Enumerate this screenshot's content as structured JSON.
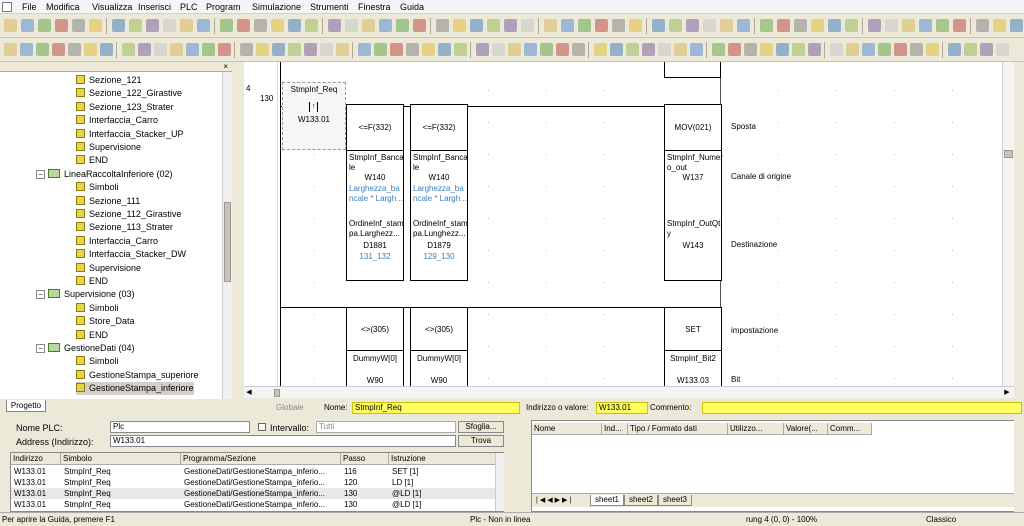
{
  "menu": [
    "File",
    "Modifica",
    "Visualizza",
    "Inserisci",
    "PLC",
    "Program",
    "Simulazione",
    "Strumenti",
    "Finestra",
    "Guida"
  ],
  "tree": {
    "items": [
      {
        "label": "Sezione_121",
        "type": "section",
        "indent": 2
      },
      {
        "label": "Sezione_122_Girastive",
        "type": "section",
        "indent": 2
      },
      {
        "label": "Sezione_123_Strater",
        "type": "section",
        "indent": 2
      },
      {
        "label": "Interfaccia_Carro",
        "type": "section",
        "indent": 2
      },
      {
        "label": "Interfaccia_Stacker_UP",
        "type": "section",
        "indent": 2
      },
      {
        "label": "Supervisione",
        "type": "section",
        "indent": 2
      },
      {
        "label": "END",
        "type": "section",
        "indent": 2
      },
      {
        "label": "LineaRaccoltaInferiore (02)",
        "type": "folder",
        "indent": 1
      },
      {
        "label": "Simboli",
        "type": "section",
        "indent": 2
      },
      {
        "label": "Sezione_111",
        "type": "section",
        "indent": 2
      },
      {
        "label": "Sezione_112_Girastive",
        "type": "section",
        "indent": 2
      },
      {
        "label": "Sezione_113_Strater",
        "type": "section",
        "indent": 2
      },
      {
        "label": "Interfaccia_Carro",
        "type": "section",
        "indent": 2
      },
      {
        "label": "Interfaccia_Stacker_DW",
        "type": "section",
        "indent": 2
      },
      {
        "label": "Supervisione",
        "type": "section",
        "indent": 2
      },
      {
        "label": "END",
        "type": "section",
        "indent": 2
      },
      {
        "label": "Supervisione (03)",
        "type": "folder",
        "indent": 1
      },
      {
        "label": "Simboli",
        "type": "section",
        "indent": 2
      },
      {
        "label": "Store_Data",
        "type": "section",
        "indent": 2
      },
      {
        "label": "END",
        "type": "section",
        "indent": 2
      },
      {
        "label": "GestioneDati (04)",
        "type": "folder",
        "indent": 1
      },
      {
        "label": "Simboli",
        "type": "section",
        "indent": 2
      },
      {
        "label": "GestioneStampa_superiore",
        "type": "section",
        "indent": 2
      },
      {
        "label": "GestioneStampa_inferiore",
        "type": "section",
        "indent": 2,
        "selected": true
      }
    ],
    "tab_label": "Progetto"
  },
  "ladder": {
    "rung_number": "4",
    "step_number": "130",
    "contact": {
      "symbol": "StmpInf_Req",
      "address": "W133.01"
    },
    "blocks": [
      {
        "op": "<=F(332)",
        "op1": "StmpInf_Banca le",
        "op1_addr": "W140",
        "op1_cmt": "Larghezza_ba ncale * Largh...",
        "op2": "OrdineInf_stam pa.Larghezz...",
        "op2_addr": "D1881",
        "op2_cmt": "131_132"
      },
      {
        "op": "<=F(332)",
        "op1": "StmpInf_Banca le",
        "op1_addr": "W140",
        "op1_cmt": "Larghezza_ba ncale * Largh...",
        "op2": "OrdineInf_stam pa.Lunghezz...",
        "op2_addr": "D1879",
        "op2_cmt": "129_130"
      },
      {
        "op": "MOV(021)",
        "op1": "StmpInf_Numer o_out",
        "op1_addr": "W137",
        "op2": "StmpInf_OutQt y",
        "op2_addr": "W143"
      }
    ],
    "lower_blocks": [
      {
        "op": "<>(305)",
        "op1": "DummyW[0]",
        "op1_addr": "W90"
      },
      {
        "op": "<>(305)",
        "op1": "DummyW[0]",
        "op1_addr": "W90"
      },
      {
        "op": "SET",
        "op1": "StmpInf_Bit2",
        "op1_addr": "W133.03"
      }
    ],
    "comments": [
      "Sposta",
      "Canale di origine",
      "Destinazione",
      "impostazione",
      "Bit"
    ]
  },
  "infobar": {
    "tab": "Globale",
    "name_label": "Nome:",
    "name_value": "StmpInf_Req",
    "addr_label": "Indirizzo o valore:",
    "addr_value": "W133.01",
    "comment_label": "Commento:",
    "comment_value": ""
  },
  "search": {
    "plc_label": "Nome PLC:",
    "plc_value": "Plc",
    "interval_label": "Intervallo:",
    "interval_value": "Tutti",
    "browse_label": "Sfoglia...",
    "address_label": "Address (Indirizzo):",
    "address_value": "W133.01",
    "find_label": "Trova",
    "columns": [
      "Indirizzo",
      "Simbolo",
      "Programma/Sezione",
      "Passo",
      "Istruzione"
    ],
    "rows": [
      [
        "W133.01",
        "StmpInf_Req",
        "GestioneDati/GestioneStampa_inferio...",
        "116",
        "SET [1]"
      ],
      [
        "W133.01",
        "StmpInf_Req",
        "GestioneDati/GestioneStampa_inferio...",
        "120",
        "LD [1]"
      ],
      [
        "W133.01",
        "StmpInf_Req",
        "GestioneDati/GestioneStampa_inferio...",
        "130",
        "@LD [1]"
      ],
      [
        "W133.01",
        "StmpInf_Req",
        "GestioneDati/GestioneStampa_inferio...",
        "130",
        "@LD [1]"
      ]
    ]
  },
  "watch": {
    "columns": [
      "Nome",
      "Ind...",
      "Tipo / Formato dati",
      "Utilizzo...",
      "Valore(...",
      "Comm..."
    ],
    "sheets": [
      "sheet1",
      "sheet2",
      "sheet3"
    ]
  },
  "status": {
    "help": "Per aprire la Guida, premere F1",
    "plc": "Plc - Non in linea",
    "rung": "rung 4 (0, 0)  - 100%",
    "mode": "Classico"
  },
  "colors": {
    "highlight": "#ffff60",
    "link": "#3a7fc0",
    "selected": "#d4d0c8"
  }
}
